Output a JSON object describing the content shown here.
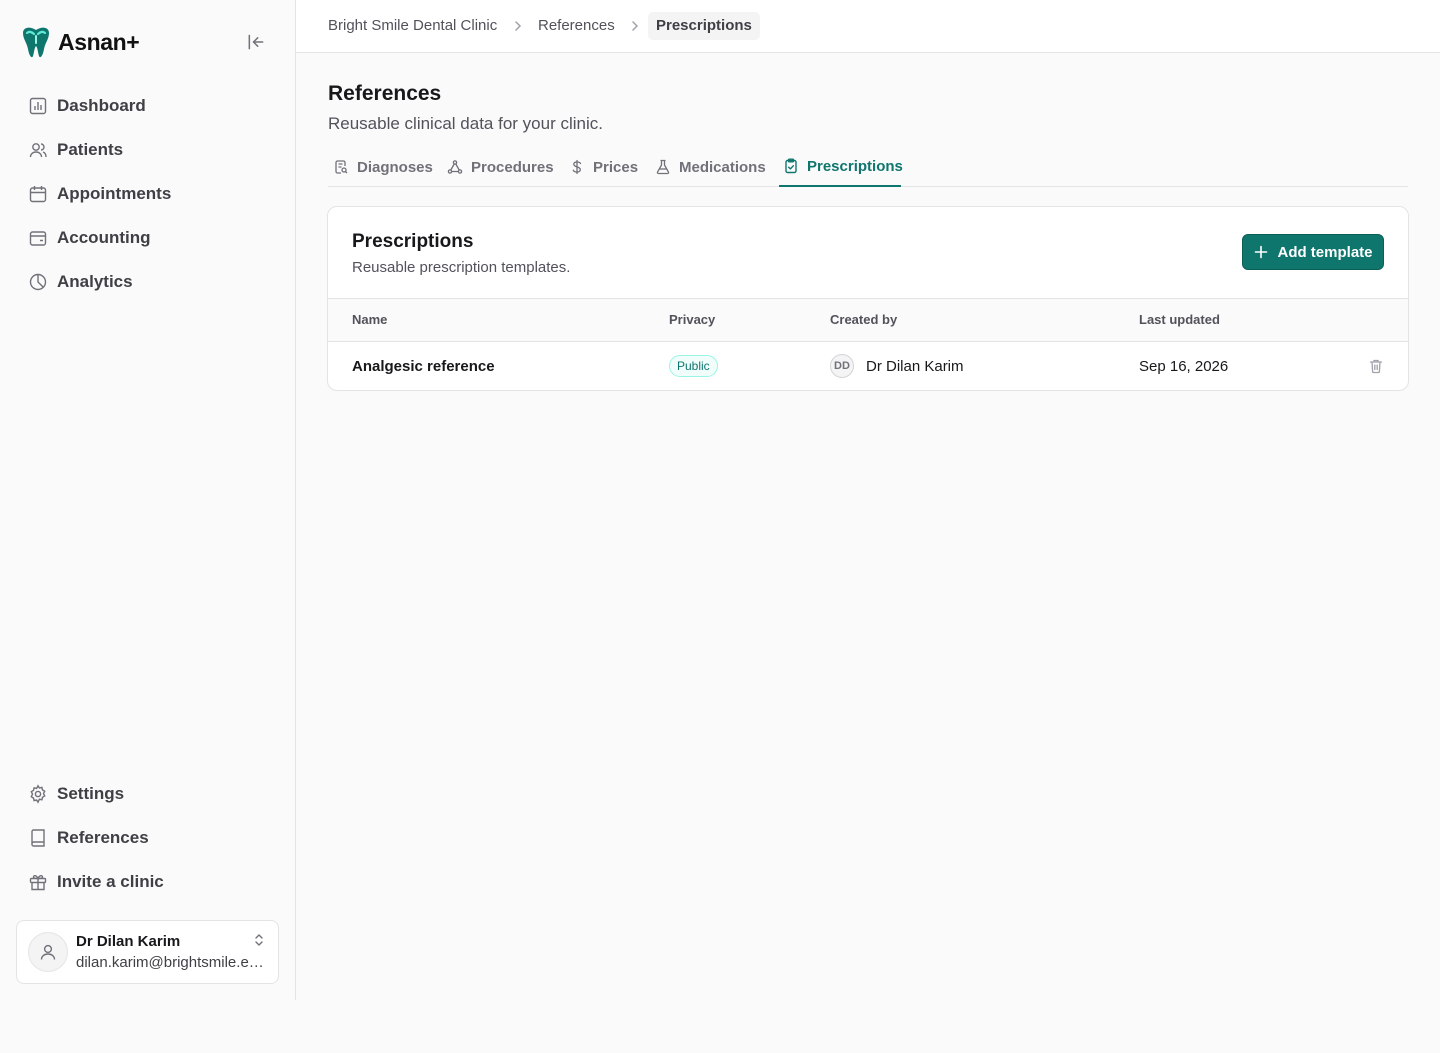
{
  "brand": {
    "name": "Asnan+",
    "accent": "#0f766e"
  },
  "sidebar": {
    "items": [
      {
        "label": "Dashboard",
        "icon": "chart-icon"
      },
      {
        "label": "Patients",
        "icon": "users-icon"
      },
      {
        "label": "Appointments",
        "icon": "calendar-icon"
      },
      {
        "label": "Accounting",
        "icon": "wallet-icon"
      },
      {
        "label": "Analytics",
        "icon": "pie-chart-icon"
      }
    ],
    "bottom_items": [
      {
        "label": "Settings",
        "icon": "gear-icon"
      },
      {
        "label": "References",
        "icon": "book-icon"
      },
      {
        "label": "Invite a clinic",
        "icon": "gift-icon"
      }
    ],
    "user": {
      "name": "Dr Dilan Karim",
      "email": "dilan.karim@brightsmile.example.com"
    }
  },
  "breadcrumb": {
    "clinic": "Bright Smile Dental Clinic",
    "section": "References",
    "current": "Prescriptions"
  },
  "page": {
    "title": "References",
    "subtitle": "Reusable clinical data for your clinic."
  },
  "tabs": [
    {
      "label": "Diagnoses",
      "icon": "file-search-icon"
    },
    {
      "label": "Procedures",
      "icon": "network-icon"
    },
    {
      "label": "Prices",
      "icon": "dollar-icon"
    },
    {
      "label": "Medications",
      "icon": "flask-icon"
    },
    {
      "label": "Prescriptions",
      "icon": "clipboard-check-icon",
      "active": true
    }
  ],
  "card": {
    "title": "Prescriptions",
    "description": "Reusable prescription templates.",
    "add_label": "Add template",
    "columns": [
      "Name",
      "Privacy",
      "Created by",
      "Last updated"
    ],
    "rows": [
      {
        "name": "Analgesic reference",
        "privacy": "Public",
        "creator_initials": "DD",
        "creator": "Dr Dilan Karim",
        "updated": "Sep 16, 2026"
      }
    ]
  }
}
